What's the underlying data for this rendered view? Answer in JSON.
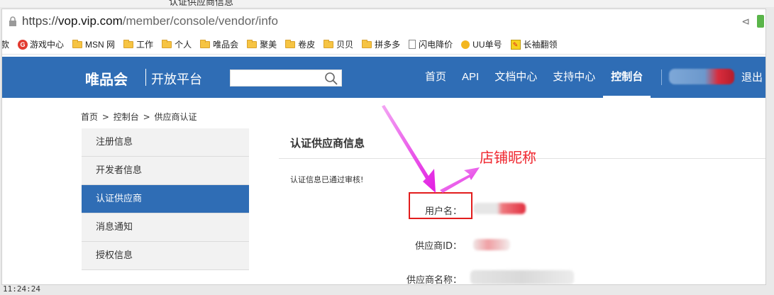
{
  "background": {
    "title_fragment": "认证供应商信息",
    "time": "11:24:24"
  },
  "browser": {
    "url_scheme": "https://",
    "url_host": "vop.vip.com",
    "url_path": "/member/console/vendor/info",
    "bookmarks": [
      {
        "label": "款",
        "icon": "none"
      },
      {
        "label": "游戏中心",
        "icon": "game-icon"
      },
      {
        "label": "MSN 网",
        "icon": "folder-icon"
      },
      {
        "label": "工作",
        "icon": "folder-icon"
      },
      {
        "label": "个人",
        "icon": "folder-icon"
      },
      {
        "label": "唯品会",
        "icon": "folder-icon"
      },
      {
        "label": "聚美",
        "icon": "folder-icon"
      },
      {
        "label": "卷皮",
        "icon": "folder-icon"
      },
      {
        "label": "贝贝",
        "icon": "folder-icon"
      },
      {
        "label": "拼多多",
        "icon": "folder-icon"
      },
      {
        "label": "闪电降价",
        "icon": "page-icon"
      },
      {
        "label": "UU单号",
        "icon": "sun-icon"
      },
      {
        "label": "长袖翻领",
        "icon": "tag-icon"
      }
    ]
  },
  "header": {
    "brand": "唯品会",
    "brand_sub": "开放平台",
    "search_placeholder": "",
    "nav": [
      {
        "label": "首页",
        "active": false
      },
      {
        "label": "API",
        "active": false
      },
      {
        "label": "文档中心",
        "active": false
      },
      {
        "label": "支持中心",
        "active": false
      },
      {
        "label": "控制台",
        "active": true
      }
    ],
    "logout": "退出"
  },
  "breadcrumb": [
    "首页",
    ">",
    "控制台",
    ">",
    "供应商认证"
  ],
  "sidebar": {
    "items": [
      {
        "label": "注册信息",
        "active": false
      },
      {
        "label": "开发者信息",
        "active": false
      },
      {
        "label": "认证供应商",
        "active": true
      },
      {
        "label": "消息通知",
        "active": false
      },
      {
        "label": "授权信息",
        "active": false
      }
    ]
  },
  "main": {
    "title": "认证供应商信息",
    "notice": "认证信息已通过审核!",
    "fields": [
      {
        "label": "用户名："
      },
      {
        "label": "供应商ID："
      },
      {
        "label": "供应商名称："
      }
    ]
  },
  "annotation": {
    "text": "店铺昵称"
  },
  "colors": {
    "header_blue": "#2f6db5",
    "arrow_magenta": "#e62ee6",
    "annotation_red": "#f0262e"
  }
}
